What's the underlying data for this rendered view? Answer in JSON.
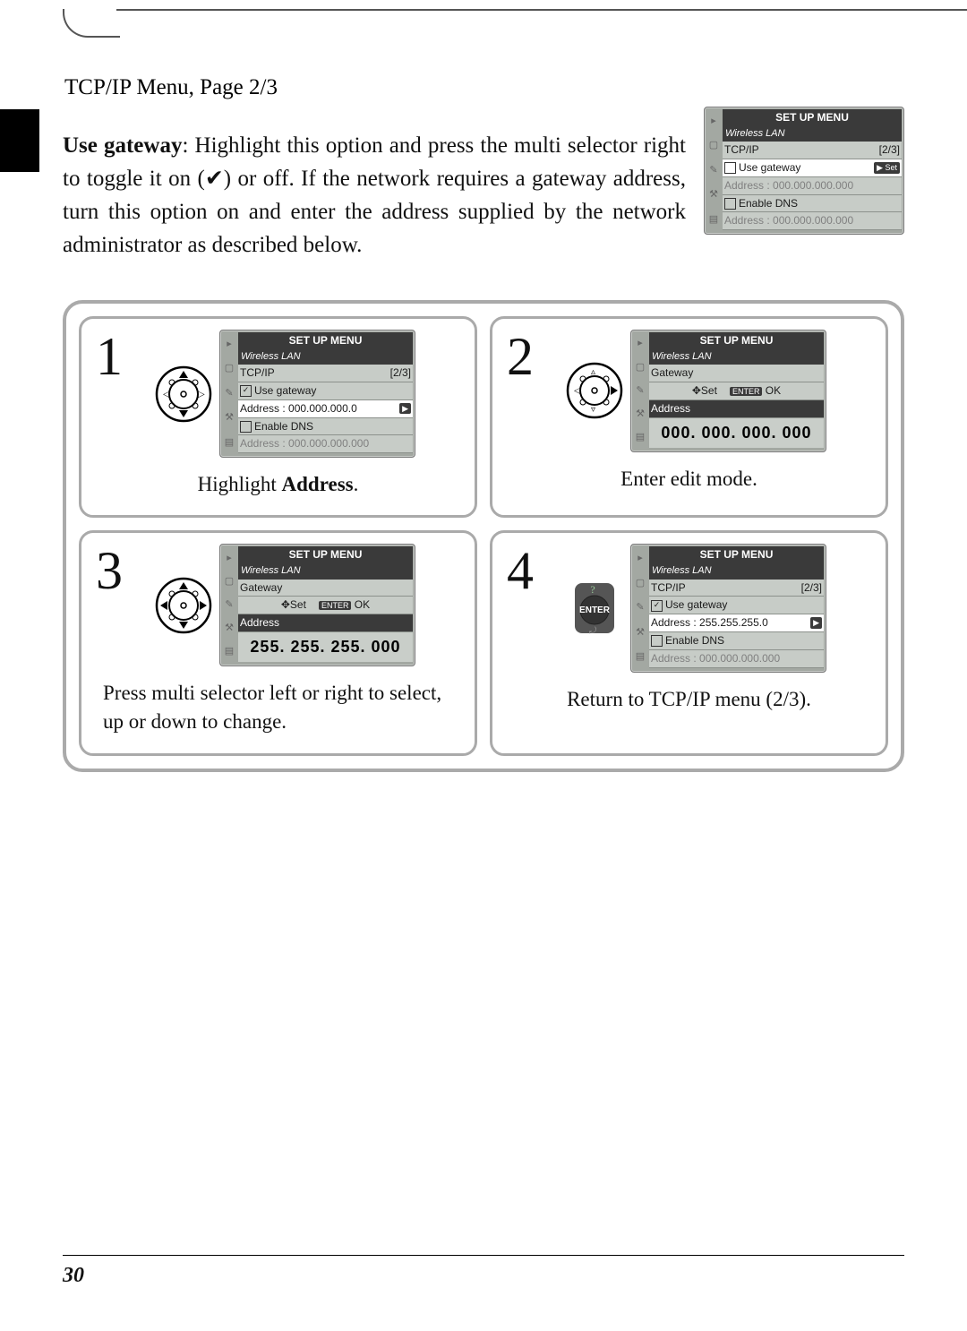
{
  "heading": "TCP/IP Menu, Page 2/3",
  "para_bold": "Use gateway",
  "para_rest": ": Highlight this option and press the multi selector right to toggle it on (✔) or off.  If the network requires a gateway address, turn this option on and enter the address supplied by the network administrator as described below.",
  "page_number": "30",
  "main_lcd": {
    "title": "SET UP MENU",
    "sub": "Wireless LAN",
    "tcpip": "TCP/IP",
    "page": "[2/3]",
    "use_gw": "Use gateway",
    "set": "▶ Set",
    "gw_addr": "Address  : 000.000.000.000",
    "enable_dns": "Enable DNS",
    "dns_addr": "Address  : 000.000.000.000"
  },
  "s1": {
    "num": "1",
    "lcd": {
      "title": "SET UP MENU",
      "sub": "Wireless LAN",
      "tcpip": "TCP/IP",
      "page": "[2/3]",
      "use_gw": "Use gateway",
      "gw_addr": "Address  : 000.000.000.0",
      "enable_dns": "Enable DNS",
      "dns_addr": "Address  : 000.000.000.000"
    },
    "cap_a": "Highlight ",
    "cap_b": "Address",
    "cap_c": "."
  },
  "s2": {
    "num": "2",
    "lcd": {
      "title": "SET UP MENU",
      "sub": "Wireless LAN",
      "gateway": "Gateway",
      "set": "Set",
      "ok": "OK",
      "addr_lab": "Address",
      "addr_val": "000. 000. 000. 000"
    },
    "cap": "Enter edit mode."
  },
  "s3": {
    "num": "3",
    "lcd": {
      "title": "SET UP MENU",
      "sub": "Wireless LAN",
      "gateway": "Gateway",
      "set": "Set",
      "ok": "OK",
      "addr_lab": "Address",
      "addr_val": "255. 255. 255. 000"
    },
    "cap": "Press multi selector left or right to select, up or down to change."
  },
  "s4": {
    "num": "4",
    "lcd": {
      "title": "SET UP MENU",
      "sub": "Wireless LAN",
      "tcpip": "TCP/IP",
      "page": "[2/3]",
      "use_gw": "Use gateway",
      "gw_addr": "Address  : 255.255.255.0",
      "enable_dns": "Enable DNS",
      "dns_addr": "Address  : 000.000.000.000"
    },
    "cap": "Return to TCP/IP menu (2/3)."
  }
}
